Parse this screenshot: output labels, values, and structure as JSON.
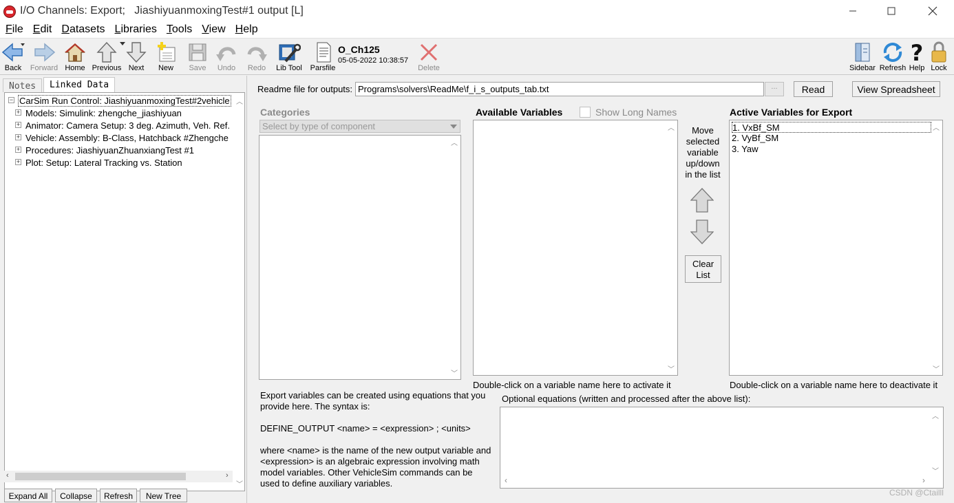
{
  "window": {
    "title": "I/O Channels: Export;   JiashiyuanmoxingTest#1 output [L]",
    "controls": [
      "—",
      "☐",
      "✕"
    ]
  },
  "menu": [
    {
      "label": "File",
      "u": "F",
      "rest": "ile"
    },
    {
      "label": "Edit",
      "u": "E",
      "rest": "dit"
    },
    {
      "label": "Datasets",
      "u": "D",
      "rest": "atasets"
    },
    {
      "label": "Libraries",
      "u": "L",
      "rest": "ibraries"
    },
    {
      "label": "Tools",
      "u": "T",
      "rest": "ools"
    },
    {
      "label": "View",
      "u": "V",
      "rest": "iew"
    },
    {
      "label": "Help",
      "u": "H",
      "rest": "elp"
    }
  ],
  "toolbar": {
    "back": "Back",
    "forward": "Forward",
    "home": "Home",
    "previous": "Previous",
    "next": "Next",
    "new": "New",
    "save": "Save",
    "undo": "Undo",
    "redo": "Redo",
    "lib_tool": "Lib Tool",
    "parsfile": "Parsfile",
    "dataset_name": "O_Ch125",
    "dataset_date": "05-05-2022 10:38:57",
    "delete": "Delete",
    "sidebar": "Sidebar",
    "refresh": "Refresh",
    "help": "Help",
    "lock": "Lock"
  },
  "left_panel": {
    "tabs": {
      "notes": "Notes",
      "linked": "Linked Data"
    },
    "tree": [
      {
        "label": "CarSim Run Control: JiashiyuanmoxingTest#2vehicle",
        "box": "−",
        "indent": 0
      },
      {
        "label": "Models: Simulink: zhengche_jiashiyuan",
        "box": "+",
        "indent": 1
      },
      {
        "label": "Animator: Camera Setup: 3 deg. Azimuth, Veh. Ref.",
        "box": "+",
        "indent": 1
      },
      {
        "label": "Vehicle: Assembly: B-Class, Hatchback #Zhengche",
        "box": "+",
        "indent": 1
      },
      {
        "label": "Procedures: JiashiyuanZhuanxiangTest #1",
        "box": "+",
        "indent": 1
      },
      {
        "label": "Plot: Setup: Lateral Tracking vs. Station",
        "box": "+",
        "indent": 1
      }
    ],
    "buttons": {
      "expand_all": "Expand All",
      "collapse": "Collapse",
      "refresh": "Refresh",
      "new_tree": "New Tree"
    }
  },
  "readme": {
    "label": "Readme file for outputs:",
    "value": "Programs\\solvers\\ReadMe\\f_i_s_outputs_tab.txt",
    "browse": "...",
    "read": "Read",
    "view_spreadsheet": "View Spreadsheet"
  },
  "categories": {
    "header": "Categories",
    "select_placeholder": "Select by type of component"
  },
  "available": {
    "header": "Available Variables",
    "show_long_names": "Show Long Names",
    "hint": "Double-click on a variable name here to activate it",
    "items": []
  },
  "move": {
    "lines": [
      "Move",
      "selected",
      "variable",
      "up/down",
      "in the list"
    ],
    "clear_line1": "Clear",
    "clear_line2": "List"
  },
  "active": {
    "header": "Active Variables for Export",
    "items": [
      "1. VxBf_SM",
      "2. VyBf_SM",
      "3. Yaw"
    ],
    "hint": "Double-click on a variable name here to deactivate it"
  },
  "help_text": {
    "p1": "Export variables can be created using equations that you provide here. The syntax is:",
    "p2": "DEFINE_OUTPUT <name> = <expression> ; <units>",
    "p3": "where <name> is the name of the new output variable and <expression> is an algebraic expression involving math model variables. Other VehicleSim commands can be used to define auxiliary variables."
  },
  "optional_equations": {
    "label": "Optional equations (written and processed after the above list):",
    "value": ""
  },
  "watermark": "CSDN @Ctailll"
}
